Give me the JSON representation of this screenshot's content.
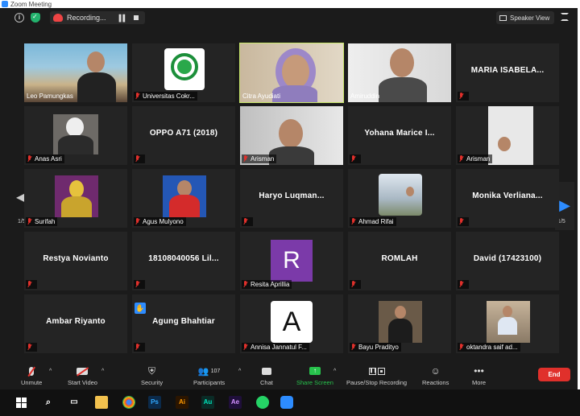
{
  "window": {
    "title": "Zoom Meeting"
  },
  "topbar": {
    "recording_label": "Recording...",
    "view_label": "Speaker View"
  },
  "participants": [
    {
      "name": "Leo Pamungkas",
      "display": "video"
    },
    {
      "name": "Universitas Cokr...",
      "display": "logo"
    },
    {
      "name": "Citra Ayudiati",
      "display": "video",
      "active_speaker": true
    },
    {
      "name": "Amiruddin",
      "display": "video"
    },
    {
      "name": "MARIA ISABELA...",
      "display": "name"
    },
    {
      "name": "Anas Asri",
      "display": "video"
    },
    {
      "name": "OPPO A71 (2018)",
      "display": "name"
    },
    {
      "name": "Arisman",
      "display": "video"
    },
    {
      "name": "Yohana Marice I...",
      "display": "name"
    },
    {
      "name": "Arisman",
      "display": "video"
    },
    {
      "name": "Surifah",
      "display": "video"
    },
    {
      "name": "Agus Mulyono",
      "display": "video"
    },
    {
      "name": "Haryo Luqman...",
      "display": "name"
    },
    {
      "name": "Ahmad Rifai",
      "display": "video"
    },
    {
      "name": "Monika Verliana...",
      "display": "name"
    },
    {
      "name": "Restya Novianto",
      "display": "name"
    },
    {
      "name": "18108040056 Lil...",
      "display": "name"
    },
    {
      "name": "Resita Aprillia",
      "display": "avatar",
      "avatar_letter": "R",
      "avatar_color": "#7b3aa9"
    },
    {
      "name": "ROMLAH",
      "display": "name"
    },
    {
      "name": "David (17423100)",
      "display": "name"
    },
    {
      "name": "Ambar Riyanto",
      "display": "name"
    },
    {
      "name": "Agung Bhahtiar",
      "display": "name",
      "hand_raised": true
    },
    {
      "name": "Annisa Jannatul F...",
      "display": "avatar",
      "avatar_letter": "A",
      "avatar_color": "#ffffff"
    },
    {
      "name": "Bayu Pradityo",
      "display": "video"
    },
    {
      "name": "oktandra saif ad...",
      "display": "video"
    }
  ],
  "pagination": {
    "prev_label": "1/5",
    "next_label": "1/5"
  },
  "controls": {
    "unmute": "Unmute",
    "start_video": "Start Video",
    "security": "Security",
    "participants": "Participants",
    "participant_count": "107",
    "chat": "Chat",
    "share_screen": "Share Screen",
    "pause_stop_recording": "Pause/Stop Recording",
    "reactions": "Reactions",
    "more": "More",
    "end": "End"
  },
  "colors": {
    "active_speaker_border": "#c9e86b",
    "end_button": "#e0302b",
    "share_screen": "#27c24c",
    "accent": "#2d8cff"
  }
}
